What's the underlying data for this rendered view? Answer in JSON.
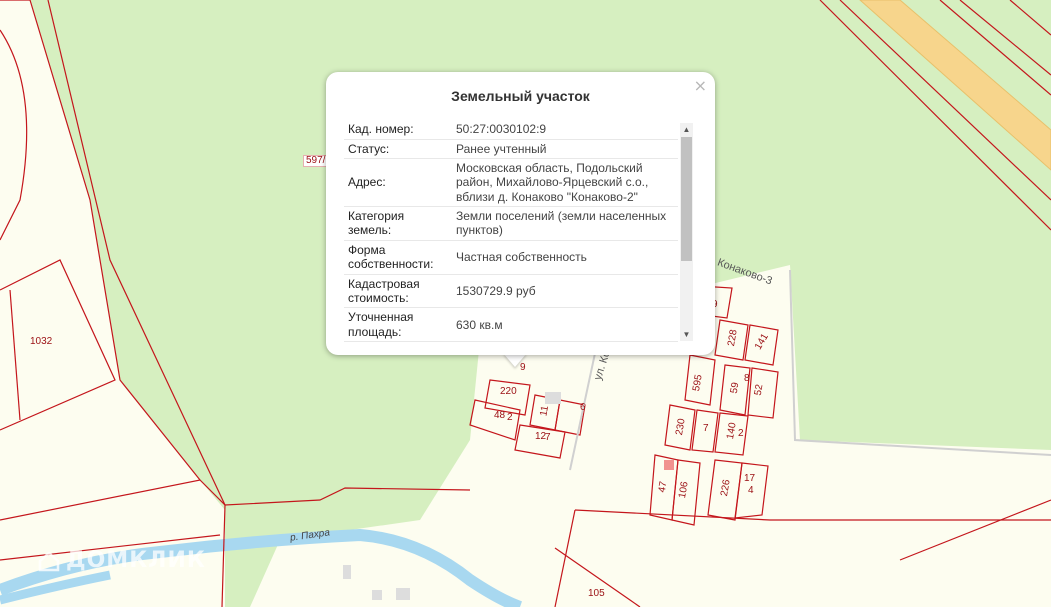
{
  "map": {
    "parcel_labels": [
      "597/",
      "1032",
      "9",
      "220",
      "48",
      "2",
      "11",
      "12",
      "7",
      "6",
      "105",
      "595",
      "59",
      "52",
      "230",
      "140",
      "228",
      "141",
      "47",
      "106",
      "226",
      "17",
      "4",
      "8",
      "9",
      "2",
      "7"
    ],
    "road_labels": [
      "ул. Конако",
      "Конаково-3"
    ],
    "river_label": "р. Пахра",
    "watermark": "ДОМКЛИК"
  },
  "popup": {
    "title": "Земельный участок",
    "close_icon": "×",
    "rows": [
      {
        "key": "Кад. номер:",
        "value": "50:27:0030102:9"
      },
      {
        "key": "Статус:",
        "value": "Ранее учтенный"
      },
      {
        "key": "Адрес:",
        "value": "Московская область, Подольский район, Михайлово-Ярцевский с.о., вблизи д. Конаково \"Конаково-2\""
      },
      {
        "key": "Категория земель:",
        "value": "Земли поселений (земли населенных пунктов)"
      },
      {
        "key": "Форма собственности:",
        "value": "Частная собственность"
      },
      {
        "key": "Кадастровая стоимость:",
        "value": "1530729.9 руб"
      },
      {
        "key": "Уточненная площадь:",
        "value": "630 кв.м"
      }
    ],
    "scroll_up": "▲",
    "scroll_down": "▼"
  },
  "colors": {
    "forest": "#d6efc0",
    "settlement": "#fdfdf0",
    "parcel_border": "#c4161c",
    "river": "#a8d8f0",
    "road": "#f7d58c"
  }
}
